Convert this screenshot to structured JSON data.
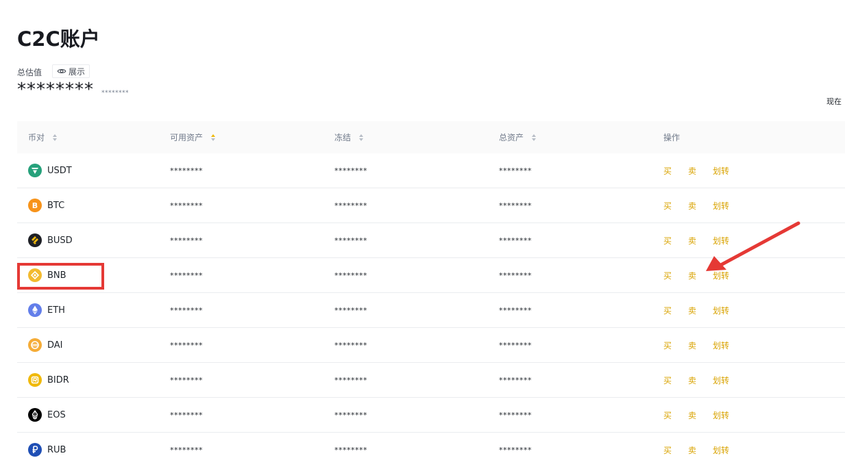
{
  "page": {
    "title": "C2C账户",
    "total_label": "总估值",
    "show_label": "展示",
    "total_value": "********",
    "total_sub": "********",
    "now_text": "现在"
  },
  "table": {
    "headers": {
      "pair": "币对",
      "available": "可用资产",
      "frozen": "冻结",
      "total": "总资产",
      "actions": "操作"
    },
    "rows": [
      {
        "coin": "USDT",
        "available": "********",
        "frozen": "********",
        "total": "********",
        "buy": "买",
        "sell": "卖",
        "transfer": "划转"
      },
      {
        "coin": "BTC",
        "available": "********",
        "frozen": "********",
        "total": "********",
        "buy": "买",
        "sell": "卖",
        "transfer": "划转"
      },
      {
        "coin": "BUSD",
        "available": "********",
        "frozen": "********",
        "total": "********",
        "buy": "买",
        "sell": "卖",
        "transfer": "划转"
      },
      {
        "coin": "BNB",
        "available": "********",
        "frozen": "********",
        "total": "********",
        "buy": "买",
        "sell": "卖",
        "transfer": "划转"
      },
      {
        "coin": "ETH",
        "available": "********",
        "frozen": "********",
        "total": "********",
        "buy": "买",
        "sell": "卖",
        "transfer": "划转"
      },
      {
        "coin": "DAI",
        "available": "********",
        "frozen": "********",
        "total": "********",
        "buy": "买",
        "sell": "卖",
        "transfer": "划转"
      },
      {
        "coin": "BIDR",
        "available": "********",
        "frozen": "********",
        "total": "********",
        "buy": "买",
        "sell": "卖",
        "transfer": "划转"
      },
      {
        "coin": "EOS",
        "available": "********",
        "frozen": "********",
        "total": "********",
        "buy": "买",
        "sell": "卖",
        "transfer": "划转"
      },
      {
        "coin": "RUB",
        "available": "********",
        "frozen": "********",
        "total": "********",
        "buy": "买",
        "sell": "卖",
        "transfer": "划转"
      }
    ]
  },
  "colors": {
    "accent": "#d9a300",
    "annotation": "#e53935",
    "header_bg": "#fafafa",
    "sort_active": "#f0b90b"
  },
  "icons": {
    "USDT": "usdt-icon",
    "BTC": "btc-icon",
    "BUSD": "busd-icon",
    "BNB": "bnb-icon",
    "ETH": "eth-icon",
    "DAI": "dai-icon",
    "BIDR": "bidr-icon",
    "EOS": "eos-icon",
    "RUB": "rub-icon"
  }
}
